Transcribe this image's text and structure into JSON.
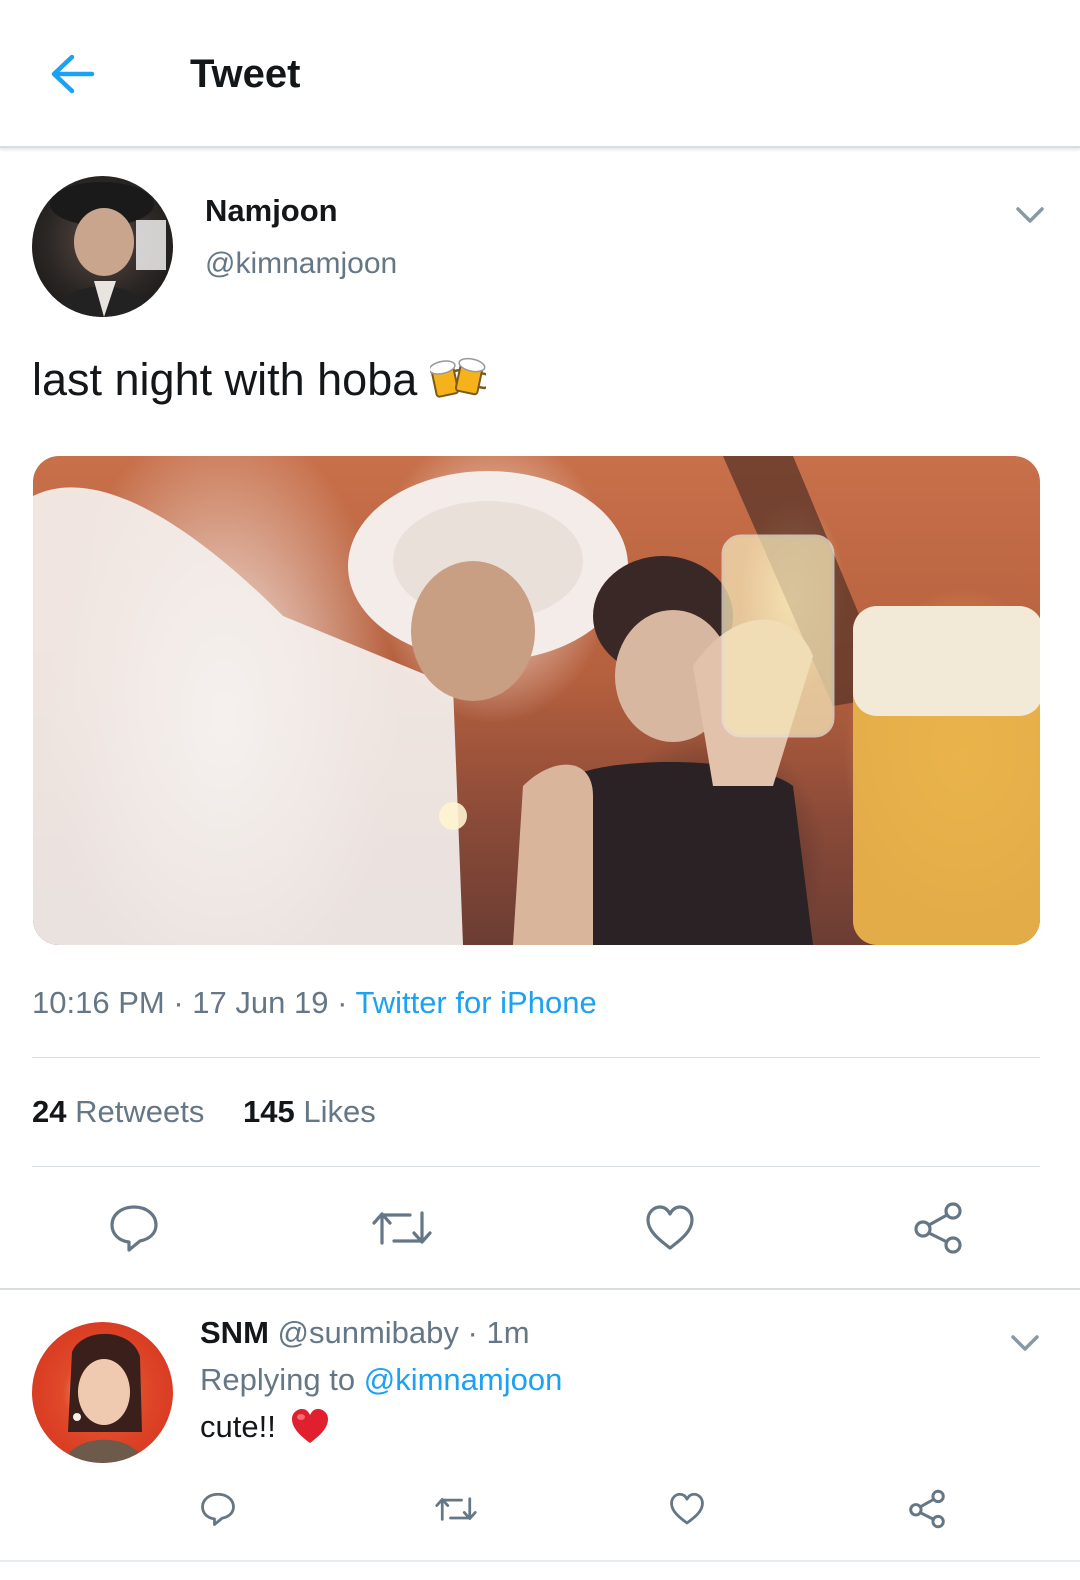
{
  "header": {
    "title": "Tweet"
  },
  "tweet": {
    "display_name": "Namjoon",
    "handle": "@kimnamjoon",
    "text": "last night with hoba",
    "time": "10:16 PM",
    "date": "17 Jun 19",
    "separator": "·",
    "source": "Twitter for iPhone",
    "retweets_count": "24",
    "retweets_label": "Retweets",
    "likes_count": "145",
    "likes_label": "Likes"
  },
  "reply": {
    "display_name": "SNM",
    "handle": "@sunmibaby",
    "separator": "·",
    "time": "1m",
    "replying_label": "Replying to",
    "replying_to": "@kimnamjoon",
    "text": "cute!!"
  },
  "icons": {
    "back": "arrow-left-icon",
    "caret": "chevron-down-icon",
    "reply": "reply-icon",
    "retweet": "retweet-icon",
    "like": "heart-icon",
    "share": "share-icon",
    "beer": "beer-mugs-emoji",
    "heart_emoji": "red-heart-emoji"
  },
  "colors": {
    "accent": "#1da1f2",
    "text": "#14171a",
    "secondary": "#657786",
    "divider": "#d8dde1"
  }
}
